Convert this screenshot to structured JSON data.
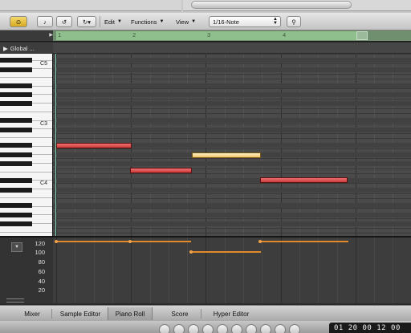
{
  "toolbar": {
    "edit_label": "Edit",
    "functions_label": "Functions",
    "view_label": "View",
    "quantize_value": "1/16-Note"
  },
  "ruler": {
    "bars": [
      "1",
      "2",
      "3",
      "4"
    ]
  },
  "global_tracks": {
    "label": "Global ..."
  },
  "keyboard": {
    "octave_labels": [
      "C5",
      "C3",
      "C4"
    ]
  },
  "notes": [
    {
      "name": "note-1",
      "start_bar": 1.0,
      "length_beats": 4,
      "row": "upper",
      "selected": false
    },
    {
      "name": "note-2",
      "start_bar": 2.0,
      "length_beats": 3,
      "row": "low",
      "selected": false
    },
    {
      "name": "note-3",
      "start_bar": 2.8,
      "length_beats": 3.5,
      "row": "mid",
      "selected": true
    },
    {
      "name": "note-4",
      "start_bar": 3.75,
      "length_beats": 4.5,
      "row": "lowest",
      "selected": false
    }
  ],
  "velocity": {
    "scale_labels": [
      "120",
      "100",
      "80",
      "60",
      "40",
      "20"
    ]
  },
  "tabs": [
    {
      "label": "Mixer",
      "active": false
    },
    {
      "label": "Sample Editor",
      "active": false
    },
    {
      "label": "Piano Roll",
      "active": true
    },
    {
      "label": "Score",
      "active": false
    },
    {
      "label": "Hyper Editor",
      "active": false
    }
  ],
  "transport": {
    "position_display": "01  20  00  12 00"
  },
  "colors": {
    "note_fill": "#e05050",
    "note_selected_fill": "#f5d58a",
    "velocity_line": "#e08a2c",
    "cycle_region": "#8fbf8c",
    "playhead": "#7fd3b0"
  }
}
